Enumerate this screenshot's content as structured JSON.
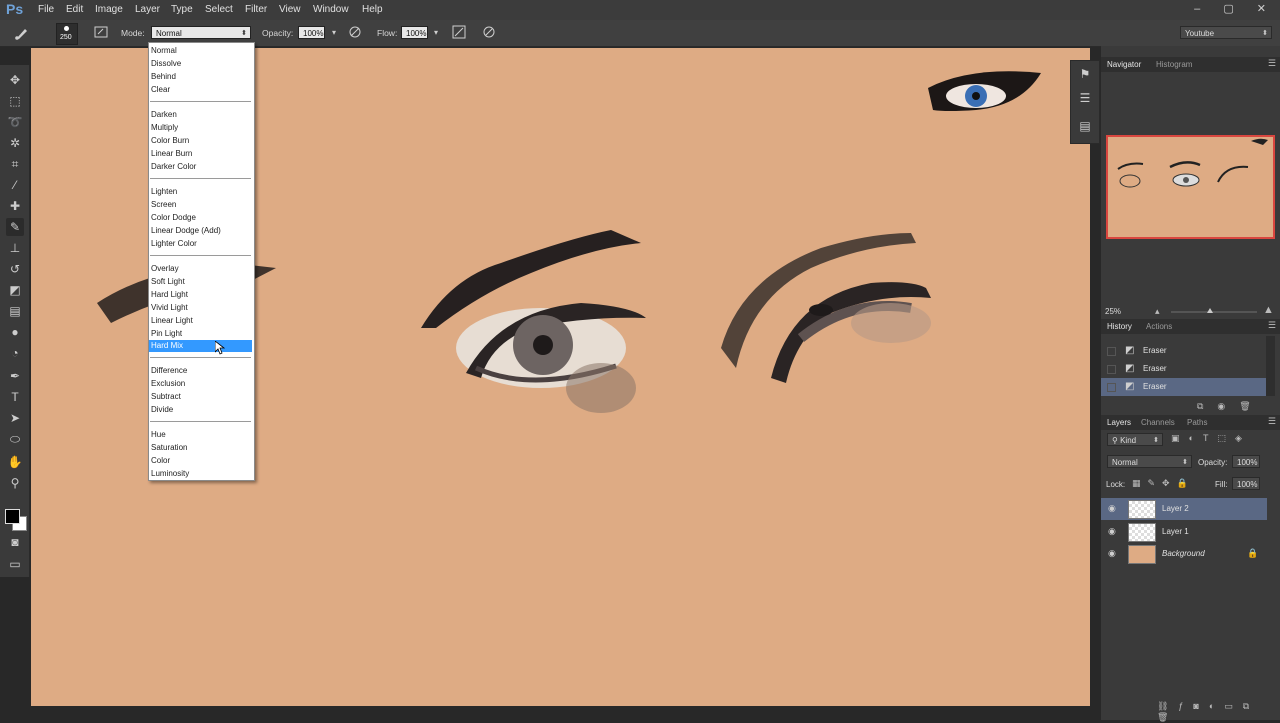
{
  "app": {
    "logo": "Ps"
  },
  "menubar": {
    "items": [
      "File",
      "Edit",
      "Image",
      "Layer",
      "Type",
      "Select",
      "Filter",
      "View",
      "Window",
      "Help"
    ],
    "window_controls": "– ▢ ✕"
  },
  "options": {
    "brush_size": "250",
    "mode_label": "Mode:",
    "mode_value": "Normal",
    "opacity_label": "Opacity:",
    "opacity_value": "100%",
    "flow_label": "Flow:",
    "flow_value": "100%",
    "workspace": "Youtube"
  },
  "blend_menu": {
    "groups": [
      [
        "Normal",
        "Dissolve",
        "Behind",
        "Clear"
      ],
      [
        "Darken",
        "Multiply",
        "Color Burn",
        "Linear Burn",
        "Darker Color"
      ],
      [
        "Lighten",
        "Screen",
        "Color Dodge",
        "Linear Dodge (Add)",
        "Lighter Color"
      ],
      [
        "Overlay",
        "Soft Light",
        "Hard Light",
        "Vivid Light",
        "Linear Light",
        "Pin Light",
        "Hard Mix"
      ],
      [
        "Difference",
        "Exclusion",
        "Subtract",
        "Divide"
      ],
      [
        "Hue",
        "Saturation",
        "Color",
        "Luminosity"
      ]
    ],
    "selected": "Hard Mix"
  },
  "navigator": {
    "tabs": [
      "Navigator",
      "Histogram"
    ],
    "zoom": "25%",
    "zoom_level": 0.45
  },
  "history": {
    "tabs": [
      "History",
      "Actions"
    ],
    "items": [
      "Eraser",
      "Eraser",
      "Eraser"
    ]
  },
  "layers": {
    "tabs": [
      "Layers",
      "Channels",
      "Paths"
    ],
    "filter_kind": "Kind",
    "blend_mode": "Normal",
    "opacity_label": "Opacity:",
    "opacity_value": "100%",
    "lock_label": "Lock:",
    "fill_label": "Fill:",
    "fill_value": "100%",
    "items": [
      {
        "name": "Layer 2",
        "selected": true
      },
      {
        "name": "Layer 1",
        "selected": false
      },
      {
        "name": "Background",
        "selected": false,
        "locked": true
      }
    ]
  },
  "colors": {
    "canvas": "#deab84",
    "accent": "#3399ff",
    "nav_frame": "#d9463f"
  },
  "icons": [
    "brush-icon",
    "move-icon",
    "marquee-icon",
    "lasso-icon",
    "magic-wand-icon",
    "crop-icon",
    "eyedropper-icon",
    "healing-icon",
    "brush-tool-icon",
    "stamp-icon",
    "history-brush-icon",
    "eraser-icon",
    "gradient-icon",
    "blur-icon",
    "dodge-icon",
    "pen-icon",
    "type-icon",
    "path-select-icon",
    "shape-icon",
    "hand-icon",
    "zoom-icon",
    "eye-icon",
    "lock-icon"
  ]
}
